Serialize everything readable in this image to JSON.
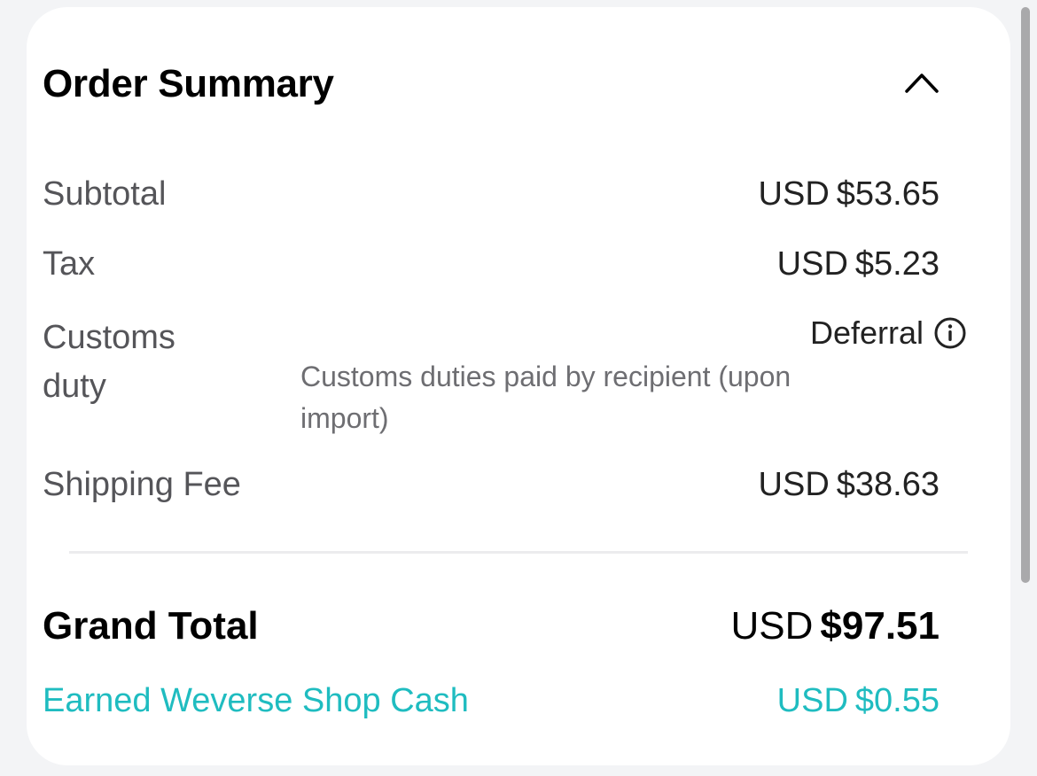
{
  "summary": {
    "title": "Order Summary",
    "collapse_icon": "chevron-up-icon"
  },
  "rows": {
    "subtotal": {
      "label": "Subtotal",
      "currency": "USD",
      "amount": "$53.65"
    },
    "tax": {
      "label": "Tax",
      "currency": "USD",
      "amount": "$5.23"
    },
    "customs": {
      "label": "Customs duty",
      "value": "Deferral",
      "info_icon": "info-icon",
      "note": "Customs duties paid by recipient (upon import)"
    },
    "shipping": {
      "label": "Shipping Fee",
      "currency": "USD",
      "amount": "$38.63"
    }
  },
  "grand_total": {
    "label": "Grand Total",
    "currency": "USD",
    "amount": "$97.51"
  },
  "cash": {
    "label": "Earned Weverse Shop Cash",
    "currency": "USD",
    "amount": "$0.55"
  },
  "colors": {
    "accent": "#1fbcc0",
    "card_bg": "#ffffff",
    "page_bg": "#f3f4f6"
  }
}
